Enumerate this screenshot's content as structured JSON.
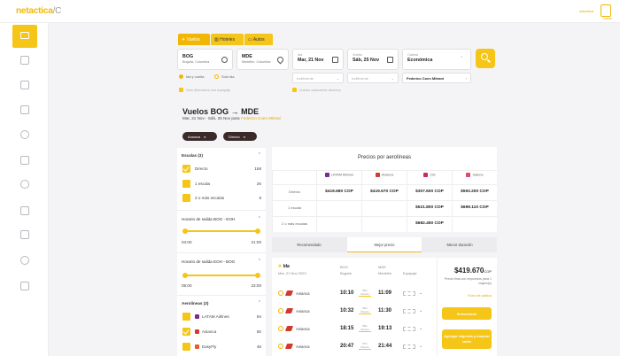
{
  "header": {
    "logo_main": "netactica",
    "logo_rest": "/C",
    "user_label": "netactica",
    "cart_label": "Carrito"
  },
  "search": {
    "tabs": [
      "Vuelos",
      "Hoteles",
      "Autos"
    ],
    "origin": {
      "code": "BOG",
      "city": "Bogotá, Colombia"
    },
    "destination": {
      "code": "MDE",
      "city": "Medellín, Colombia"
    },
    "depart": {
      "label": "Ida",
      "value": "Mar, 21 Nov"
    },
    "return": {
      "label": "Vuelta",
      "value": "Sáb, 25 Nov"
    },
    "cabin": {
      "label": "Cabina",
      "value": "Económica"
    },
    "trip_type": [
      "Ida y vuelta",
      "Solo ida"
    ],
    "option_baggage": "Solo itinerarios con equipaje",
    "option_direct": "Vuelos solamente directos",
    "select1": "Indiferente",
    "select2": "Indiferente",
    "traveler": "Federico Coen Mitrani"
  },
  "results": {
    "title": "Vuelos BOG → MDE",
    "subtitle_dates": "Mar, 21 Nov - Sáb, 25 Nov para",
    "subtitle_name": "Federico Coen Mitrani",
    "chips": [
      "Avianca",
      "Directo"
    ]
  },
  "filters": {
    "stops_title": "Escalas (3)",
    "stops": [
      {
        "label": "Directo",
        "count": "158"
      },
      {
        "label": "1 escala",
        "count": "26"
      },
      {
        "label": "2 o más escalas",
        "count": "9"
      }
    ],
    "out_title": "Horario de salida BOG - EOH",
    "out_from": "04:00",
    "out_to": "21:00",
    "ret_title": "Horario de salida EOH - BOG",
    "ret_from": "05:00",
    "ret_to": "23:00",
    "airlines_title": "Aerolíneas (3)",
    "airlines": [
      {
        "label": "LATAM Airlines",
        "count": "94"
      },
      {
        "label": "Avianca",
        "count": "50"
      },
      {
        "label": "EasyFly",
        "count": "46"
      }
    ]
  },
  "prices": {
    "title": "Precios por aerolíneas",
    "airlines": [
      "LATAM Airlines",
      "Avianca",
      "Clic",
      "Satena"
    ],
    "rows": [
      {
        "label": "Directo",
        "values": [
          "$419.680 COP",
          "$419.670 COP",
          "$307.600 COP",
          "$593.200 COP"
        ]
      },
      {
        "label": "1 escala",
        "values": [
          "",
          "",
          "$521.800 COP",
          "$699.110 COP"
        ]
      },
      {
        "label": "2 o más escalas",
        "values": [
          "",
          "",
          "$682.450 COP",
          ""
        ]
      }
    ]
  },
  "sort": [
    "Recomendado",
    "Mejor precio",
    "Menor duración"
  ],
  "flight": {
    "leg": "Ida",
    "leg_date": "Mar, 21 Nov 2023",
    "col_from": "BOG",
    "col_from_city": "Bogotá",
    "col_to": "MDE",
    "col_to_city": "Medellín",
    "col_bags": "Equipaje",
    "rows": [
      {
        "airline": "Avianca",
        "dep": "10:10",
        "dur": "55m Directo",
        "arr": "11:09"
      },
      {
        "airline": "Avianca",
        "dep": "10:32",
        "dur": "58m Directo",
        "arr": "11:30"
      },
      {
        "airline": "Avianca",
        "dep": "18:15",
        "dur": "58m Directo",
        "arr": "19:13"
      },
      {
        "airline": "Avianca",
        "dep": "20:47",
        "dur": "57m Directo",
        "arr": "21:44"
      }
    ],
    "price": "$419.670",
    "price_cur": "COP",
    "price_note": "Precio final con impuestos para 1 viajero(s)",
    "price_link": "Fuera de política",
    "btn_select": "Seleccionar",
    "btn_add": "Agregar viajero/a y mejorar tarifa"
  },
  "colors": {
    "accent": "#f5c518",
    "accent_dark": "#f2b705",
    "avianca": "#d13a2f"
  }
}
